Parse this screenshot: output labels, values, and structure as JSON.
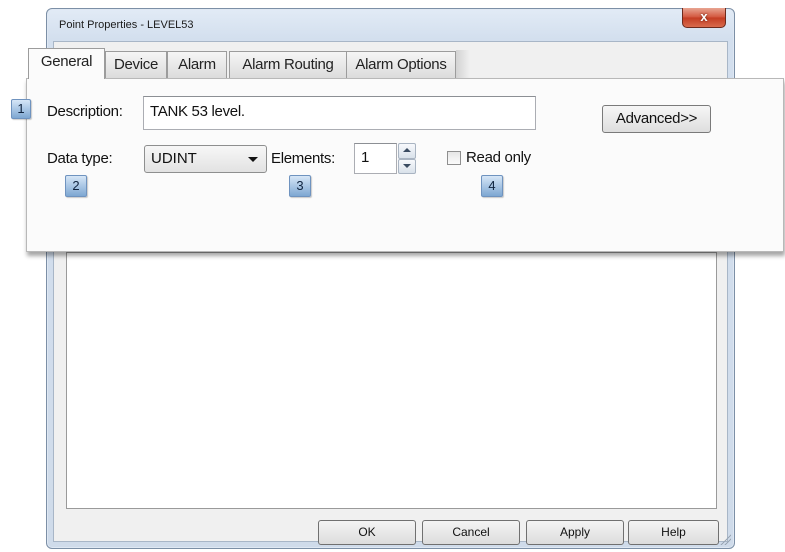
{
  "window": {
    "title": "Point Properties - LEVEL53",
    "close_glyph": "x"
  },
  "tabs": [
    {
      "label": "General",
      "active": true
    },
    {
      "label": "Device",
      "active": false
    },
    {
      "label": "Alarm",
      "active": false
    },
    {
      "label": "Alarm Routing",
      "active": false
    },
    {
      "label": "Alarm Options",
      "active": false
    }
  ],
  "general": {
    "description_label": "Description:",
    "description_value": "TANK 53 level.",
    "advanced_label": "Advanced>>",
    "data_type_label": "Data type:",
    "data_type_value": "UDINT",
    "elements_label": "Elements:",
    "elements_value": "1",
    "read_only_label": "Read only",
    "read_only_checked": false
  },
  "markers": [
    "1",
    "2",
    "3",
    "4"
  ],
  "footer": {
    "ok": "OK",
    "cancel": "Cancel",
    "apply": "Apply",
    "help": "Help"
  },
  "colors": {
    "close_button": "#d2543b",
    "marker": "#7ea7d2"
  }
}
